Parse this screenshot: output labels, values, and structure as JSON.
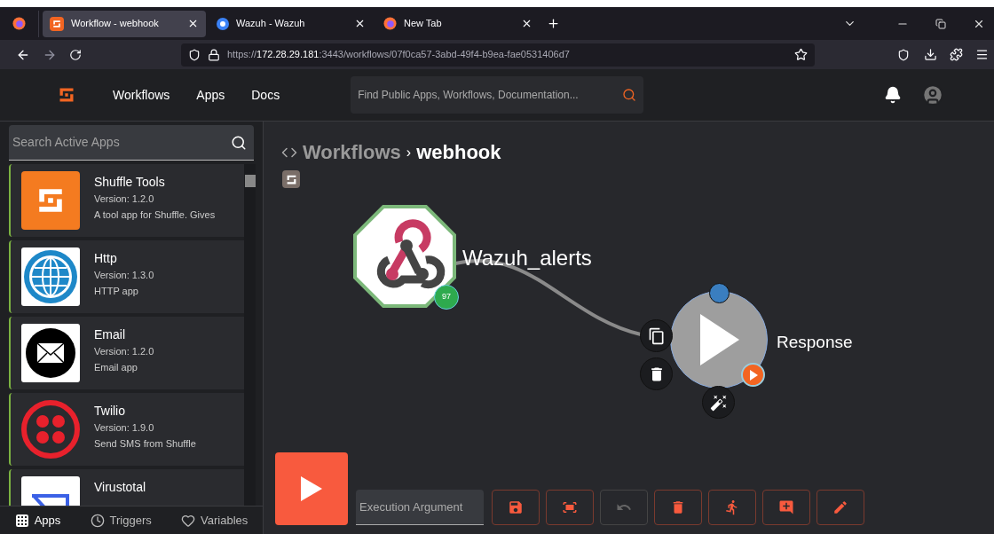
{
  "browser": {
    "tabs": [
      {
        "title": "Workflow - webhook",
        "kind": "shuffle",
        "selected": true
      },
      {
        "title": "Wazuh - Wazuh",
        "kind": "wazuh",
        "selected": false
      },
      {
        "title": "New Tab",
        "kind": "firefox",
        "selected": false
      }
    ],
    "url": {
      "prefix": "https://",
      "host": "172.28.29.181",
      "rest": ":3443/workflows/07f0ca57-3abd-49f4-b9ea-fae0531406d7"
    }
  },
  "header": {
    "nav": [
      "Workflows",
      "Apps",
      "Docs"
    ],
    "search": {
      "placeholder": "Find Public Apps, Workflows, Documentation..."
    }
  },
  "sidebar": {
    "search": {
      "placeholder": "Search Active Apps"
    },
    "apps": [
      {
        "name": "Shuffle Tools",
        "version": "Version: 1.2.0",
        "description": "A tool app for Shuffle. Gives",
        "kind": "shuffle"
      },
      {
        "name": "Http",
        "version": "Version: 1.3.0",
        "description": "HTTP app",
        "kind": "globe"
      },
      {
        "name": "Email",
        "version": "Version: 1.2.0",
        "description": "Email app",
        "kind": "mail"
      },
      {
        "name": "Twilio",
        "version": "Version: 1.9.0",
        "description": "Send SMS from Shuffle",
        "kind": "twilio"
      },
      {
        "name": "Virustotal",
        "kind": "virustotal"
      }
    ],
    "tabs": [
      {
        "label": "Apps",
        "kind": "grid",
        "selected": true
      },
      {
        "label": "Triggers",
        "kind": "clock",
        "selected": false
      },
      {
        "label": "Variables",
        "kind": "heart",
        "selected": false
      }
    ]
  },
  "breadcrumb": {
    "parent": "Workflows",
    "separator": "›",
    "current": "webhook"
  },
  "nodes": {
    "trigger": {
      "label": "Wazuh_alerts",
      "badge": "97"
    },
    "action": {
      "label": "Response"
    }
  },
  "toolbar": {
    "argument": {
      "placeholder": "Execution Argument"
    },
    "buttons": [
      {
        "kind": "save",
        "disabled": false
      },
      {
        "kind": "fit",
        "disabled": false
      },
      {
        "kind": "undo",
        "disabled": true
      },
      {
        "kind": "delete",
        "disabled": false
      },
      {
        "kind": "run",
        "disabled": false
      },
      {
        "kind": "comment",
        "disabled": false
      },
      {
        "kind": "edit",
        "disabled": false
      }
    ]
  }
}
